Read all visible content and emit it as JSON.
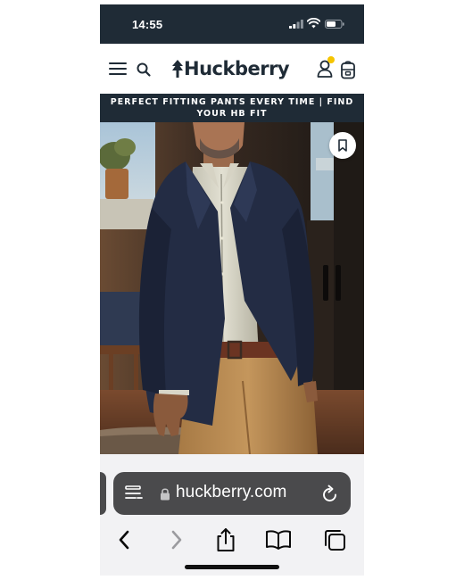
{
  "status_bar": {
    "time": "14:55"
  },
  "header": {
    "logo_text": "Huckberry",
    "menu_icon": "hamburger-icon",
    "search_icon": "search-icon",
    "account_icon": "user-icon",
    "cart_icon": "backpack-icon"
  },
  "banner": {
    "text": "PERFECT FITTING PANTS EVERY TIME | FIND YOUR HB FIT"
  },
  "hero": {
    "bookmark_icon": "bookmark-icon"
  },
  "browser": {
    "url": "huckberry.com",
    "reader_icon": "reader-mode-icon",
    "lock_icon": "lock-icon",
    "reload_icon": "reload-icon",
    "nav_icons": [
      "back-icon",
      "forward-icon",
      "share-icon",
      "bookmarks-icon",
      "tabs-icon"
    ]
  },
  "colors": {
    "navy": "#1f2b36",
    "notification_dot": "#f5c400",
    "url_bar": "#4a4a4c",
    "toolbar_bg": "#f2f2f4"
  }
}
